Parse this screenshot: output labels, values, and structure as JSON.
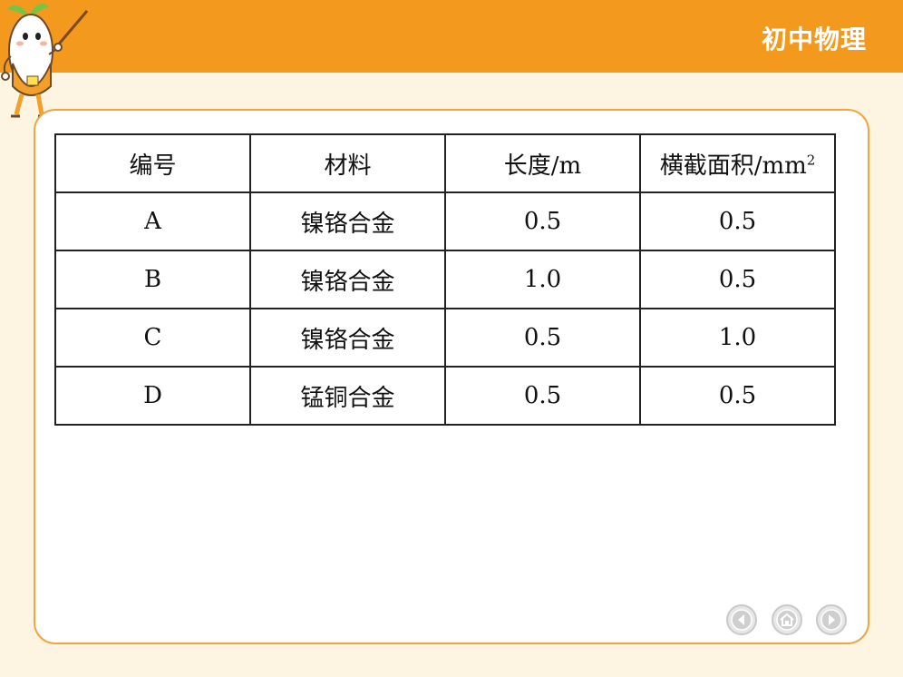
{
  "header": {
    "title": "初中物理"
  },
  "table": {
    "headers": {
      "c0": "编号",
      "c1": "材料",
      "c2": "长度/m",
      "c3": "横截面积/mm",
      "c3_sup": "2"
    },
    "rows": [
      {
        "id": "A",
        "material": "镍铬合金",
        "length": "0.5",
        "area": "0.5"
      },
      {
        "id": "B",
        "material": "镍铬合金",
        "length": "1.0",
        "area": "0.5"
      },
      {
        "id": "C",
        "material": "镍铬合金",
        "length": "0.5",
        "area": "1.0"
      },
      {
        "id": "D",
        "material": "锰铜合金",
        "length": "0.5",
        "area": "0.5"
      }
    ]
  },
  "nav": {
    "prev_icon": "left-arrow-icon",
    "home_icon": "home-icon",
    "next_icon": "right-arrow-icon"
  },
  "colors": {
    "header_bg": "#f39a1e",
    "panel_border": "#f0a640",
    "page_bg": "#fdf5e2"
  }
}
